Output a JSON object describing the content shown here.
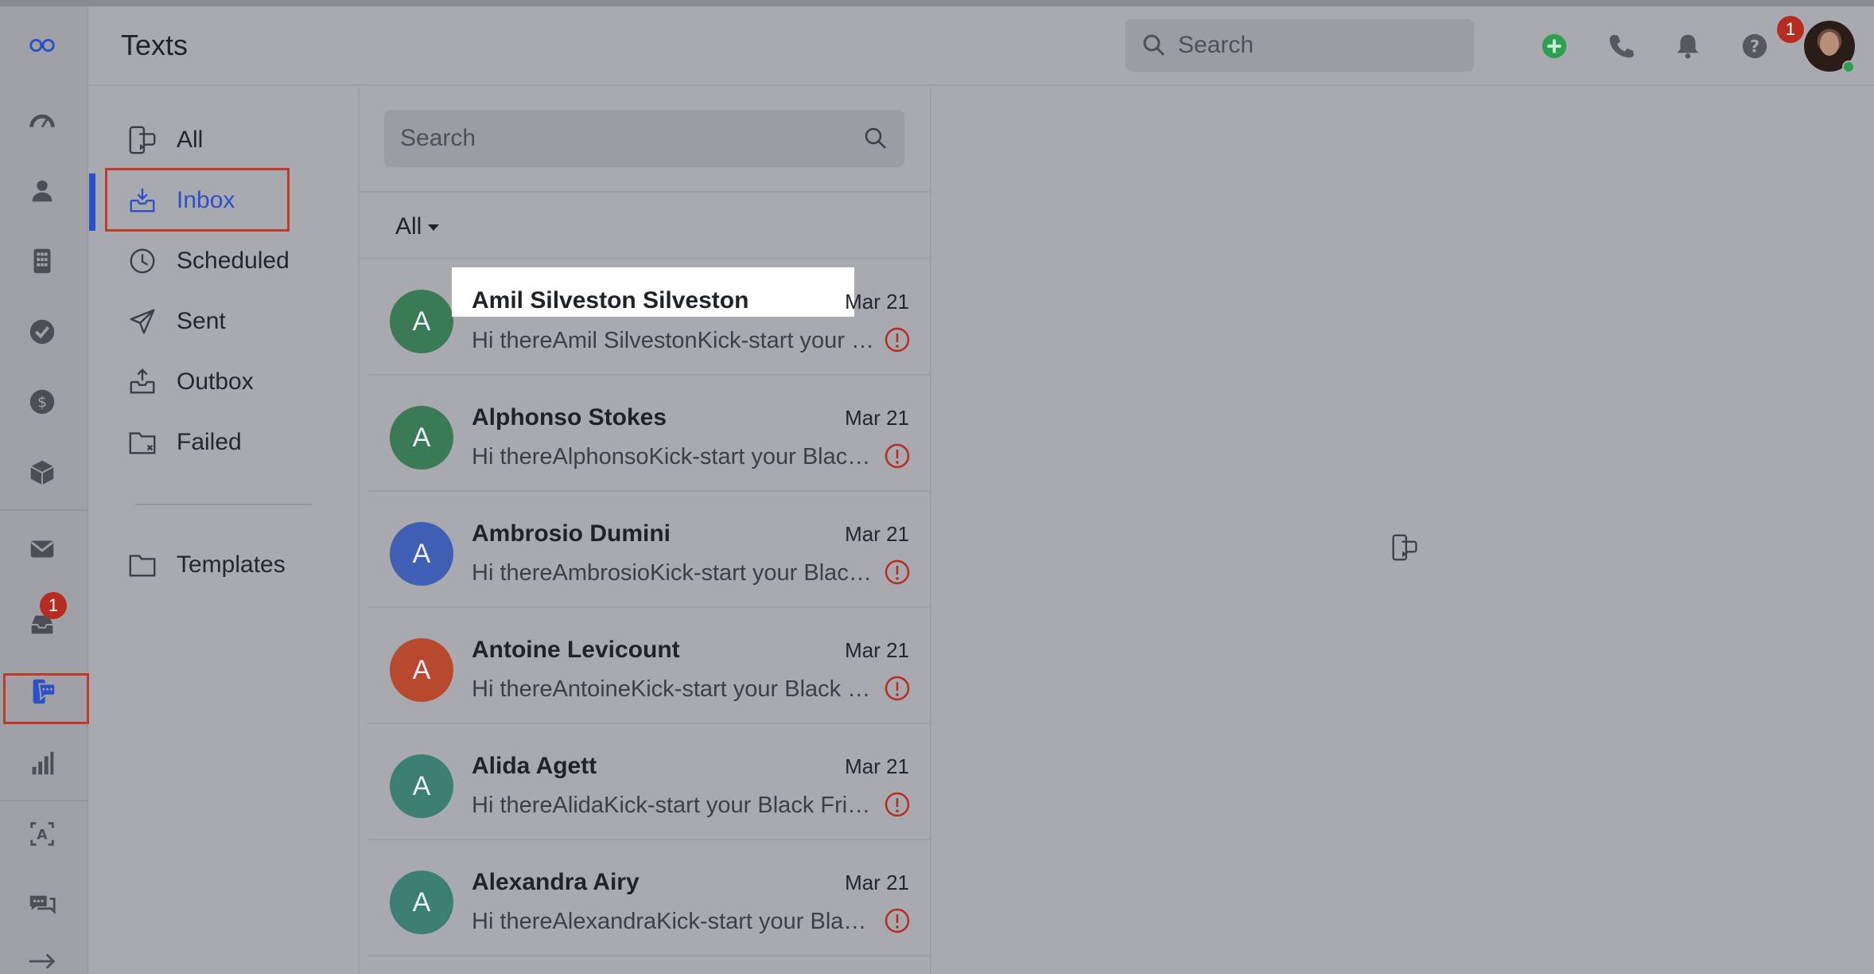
{
  "header": {
    "title": "Texts",
    "search_placeholder": "Search",
    "notification_count": "1"
  },
  "rail": {
    "inbox_badge": "1",
    "items": [
      "logo-icon",
      "dashboard-icon",
      "contacts-icon",
      "calculator-icon",
      "tasks-icon",
      "deals-icon",
      "products-icon",
      "email-icon",
      "inbox-icon",
      "texts-icon",
      "reports-icon",
      "automation-icon",
      "chat-icon",
      "expand-icon"
    ]
  },
  "folders": {
    "all": "All",
    "inbox": "Inbox",
    "scheduled": "Scheduled",
    "sent": "Sent",
    "outbox": "Outbox",
    "failed": "Failed",
    "templates": "Templates"
  },
  "list": {
    "search_placeholder": "Search",
    "filter": "All",
    "conversations": [
      {
        "initial": "A",
        "name": "Amil Silveston Silveston",
        "date": "Mar 21",
        "preview": "Hi thereAmil SilvestonKick-start your Black Friday",
        "color": "#3a7a55"
      },
      {
        "initial": "A",
        "name": "Alphonso Stokes",
        "date": "Mar 21",
        "preview": "Hi thereAlphonsoKick-start your Black Friday",
        "color": "#3a7a55"
      },
      {
        "initial": "A",
        "name": "Ambrosio Dumini",
        "date": "Mar 21",
        "preview": "Hi thereAmbrosioKick-start your Black Friday",
        "color": "#3f5fb5"
      },
      {
        "initial": "A",
        "name": "Antoine Levicount",
        "date": "Mar 21",
        "preview": "Hi thereAntoineKick-start your Black Friday",
        "color": "#b74a2c"
      },
      {
        "initial": "A",
        "name": "Alida Agett",
        "date": "Mar 21",
        "preview": "Hi thereAlidaKick-start your Black Friday",
        "color": "#3b7f73"
      },
      {
        "initial": "A",
        "name": "Alexandra Airy",
        "date": "Mar 21",
        "preview": "Hi thereAlexandraKick-start your Black Friday",
        "color": "#3b7f73"
      }
    ]
  },
  "colors": {
    "accent": "#2b50c8",
    "highlight_box": "#c0392b",
    "warning": "#b52c20"
  }
}
